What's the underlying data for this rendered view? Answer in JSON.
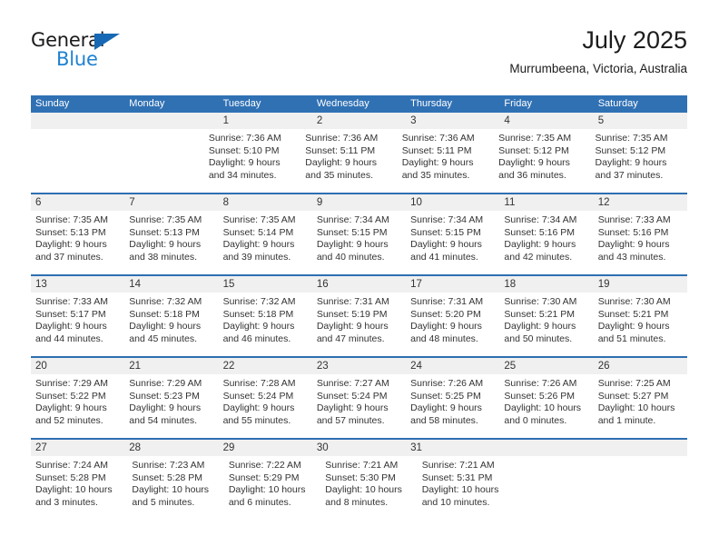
{
  "brand": {
    "name_part1": "General",
    "name_part2": "Blue"
  },
  "header": {
    "title": "July 2025",
    "subtitle": "Murrumbeena, Victoria, Australia"
  },
  "calendar": {
    "weekday_headers": [
      "Sunday",
      "Monday",
      "Tuesday",
      "Wednesday",
      "Thursday",
      "Friday",
      "Saturday"
    ],
    "colors": {
      "header_blue": "#3071b4",
      "rule_blue": "#2f6fb2",
      "daynum_band": "#f0f0f0",
      "logo_blue": "#1f81d0",
      "logo_triangle": "#1769b5"
    },
    "weeks": [
      {
        "days": [
          {
            "num": "",
            "empty": true
          },
          {
            "num": "",
            "empty": true
          },
          {
            "num": "1",
            "sunrise": "Sunrise: 7:36 AM",
            "sunset": "Sunset: 5:10 PM",
            "daylight_line1": "Daylight: 9 hours",
            "daylight_line2": "and 34 minutes."
          },
          {
            "num": "2",
            "sunrise": "Sunrise: 7:36 AM",
            "sunset": "Sunset: 5:11 PM",
            "daylight_line1": "Daylight: 9 hours",
            "daylight_line2": "and 35 minutes."
          },
          {
            "num": "3",
            "sunrise": "Sunrise: 7:36 AM",
            "sunset": "Sunset: 5:11 PM",
            "daylight_line1": "Daylight: 9 hours",
            "daylight_line2": "and 35 minutes."
          },
          {
            "num": "4",
            "sunrise": "Sunrise: 7:35 AM",
            "sunset": "Sunset: 5:12 PM",
            "daylight_line1": "Daylight: 9 hours",
            "daylight_line2": "and 36 minutes."
          },
          {
            "num": "5",
            "sunrise": "Sunrise: 7:35 AM",
            "sunset": "Sunset: 5:12 PM",
            "daylight_line1": "Daylight: 9 hours",
            "daylight_line2": "and 37 minutes."
          }
        ]
      },
      {
        "days": [
          {
            "num": "6",
            "sunrise": "Sunrise: 7:35 AM",
            "sunset": "Sunset: 5:13 PM",
            "daylight_line1": "Daylight: 9 hours",
            "daylight_line2": "and 37 minutes."
          },
          {
            "num": "7",
            "sunrise": "Sunrise: 7:35 AM",
            "sunset": "Sunset: 5:13 PM",
            "daylight_line1": "Daylight: 9 hours",
            "daylight_line2": "and 38 minutes."
          },
          {
            "num": "8",
            "sunrise": "Sunrise: 7:35 AM",
            "sunset": "Sunset: 5:14 PM",
            "daylight_line1": "Daylight: 9 hours",
            "daylight_line2": "and 39 minutes."
          },
          {
            "num": "9",
            "sunrise": "Sunrise: 7:34 AM",
            "sunset": "Sunset: 5:15 PM",
            "daylight_line1": "Daylight: 9 hours",
            "daylight_line2": "and 40 minutes."
          },
          {
            "num": "10",
            "sunrise": "Sunrise: 7:34 AM",
            "sunset": "Sunset: 5:15 PM",
            "daylight_line1": "Daylight: 9 hours",
            "daylight_line2": "and 41 minutes."
          },
          {
            "num": "11",
            "sunrise": "Sunrise: 7:34 AM",
            "sunset": "Sunset: 5:16 PM",
            "daylight_line1": "Daylight: 9 hours",
            "daylight_line2": "and 42 minutes."
          },
          {
            "num": "12",
            "sunrise": "Sunrise: 7:33 AM",
            "sunset": "Sunset: 5:16 PM",
            "daylight_line1": "Daylight: 9 hours",
            "daylight_line2": "and 43 minutes."
          }
        ]
      },
      {
        "days": [
          {
            "num": "13",
            "sunrise": "Sunrise: 7:33 AM",
            "sunset": "Sunset: 5:17 PM",
            "daylight_line1": "Daylight: 9 hours",
            "daylight_line2": "and 44 minutes."
          },
          {
            "num": "14",
            "sunrise": "Sunrise: 7:32 AM",
            "sunset": "Sunset: 5:18 PM",
            "daylight_line1": "Daylight: 9 hours",
            "daylight_line2": "and 45 minutes."
          },
          {
            "num": "15",
            "sunrise": "Sunrise: 7:32 AM",
            "sunset": "Sunset: 5:18 PM",
            "daylight_line1": "Daylight: 9 hours",
            "daylight_line2": "and 46 minutes."
          },
          {
            "num": "16",
            "sunrise": "Sunrise: 7:31 AM",
            "sunset": "Sunset: 5:19 PM",
            "daylight_line1": "Daylight: 9 hours",
            "daylight_line2": "and 47 minutes."
          },
          {
            "num": "17",
            "sunrise": "Sunrise: 7:31 AM",
            "sunset": "Sunset: 5:20 PM",
            "daylight_line1": "Daylight: 9 hours",
            "daylight_line2": "and 48 minutes."
          },
          {
            "num": "18",
            "sunrise": "Sunrise: 7:30 AM",
            "sunset": "Sunset: 5:21 PM",
            "daylight_line1": "Daylight: 9 hours",
            "daylight_line2": "and 50 minutes."
          },
          {
            "num": "19",
            "sunrise": "Sunrise: 7:30 AM",
            "sunset": "Sunset: 5:21 PM",
            "daylight_line1": "Daylight: 9 hours",
            "daylight_line2": "and 51 minutes."
          }
        ]
      },
      {
        "days": [
          {
            "num": "20",
            "sunrise": "Sunrise: 7:29 AM",
            "sunset": "Sunset: 5:22 PM",
            "daylight_line1": "Daylight: 9 hours",
            "daylight_line2": "and 52 minutes."
          },
          {
            "num": "21",
            "sunrise": "Sunrise: 7:29 AM",
            "sunset": "Sunset: 5:23 PM",
            "daylight_line1": "Daylight: 9 hours",
            "daylight_line2": "and 54 minutes."
          },
          {
            "num": "22",
            "sunrise": "Sunrise: 7:28 AM",
            "sunset": "Sunset: 5:24 PM",
            "daylight_line1": "Daylight: 9 hours",
            "daylight_line2": "and 55 minutes."
          },
          {
            "num": "23",
            "sunrise": "Sunrise: 7:27 AM",
            "sunset": "Sunset: 5:24 PM",
            "daylight_line1": "Daylight: 9 hours",
            "daylight_line2": "and 57 minutes."
          },
          {
            "num": "24",
            "sunrise": "Sunrise: 7:26 AM",
            "sunset": "Sunset: 5:25 PM",
            "daylight_line1": "Daylight: 9 hours",
            "daylight_line2": "and 58 minutes."
          },
          {
            "num": "25",
            "sunrise": "Sunrise: 7:26 AM",
            "sunset": "Sunset: 5:26 PM",
            "daylight_line1": "Daylight: 10 hours",
            "daylight_line2": "and 0 minutes."
          },
          {
            "num": "26",
            "sunrise": "Sunrise: 7:25 AM",
            "sunset": "Sunset: 5:27 PM",
            "daylight_line1": "Daylight: 10 hours",
            "daylight_line2": "and 1 minute."
          }
        ]
      },
      {
        "days": [
          {
            "num": "27",
            "sunrise": "Sunrise: 7:24 AM",
            "sunset": "Sunset: 5:28 PM",
            "daylight_line1": "Daylight: 10 hours",
            "daylight_line2": "and 3 minutes."
          },
          {
            "num": "28",
            "sunrise": "Sunrise: 7:23 AM",
            "sunset": "Sunset: 5:28 PM",
            "daylight_line1": "Daylight: 10 hours",
            "daylight_line2": "and 5 minutes."
          },
          {
            "num": "29",
            "sunrise": "Sunrise: 7:22 AM",
            "sunset": "Sunset: 5:29 PM",
            "daylight_line1": "Daylight: 10 hours",
            "daylight_line2": "and 6 minutes."
          },
          {
            "num": "30",
            "sunrise": "Sunrise: 7:21 AM",
            "sunset": "Sunset: 5:30 PM",
            "daylight_line1": "Daylight: 10 hours",
            "daylight_line2": "and 8 minutes."
          },
          {
            "num": "31",
            "sunrise": "Sunrise: 7:21 AM",
            "sunset": "Sunset: 5:31 PM",
            "daylight_line1": "Daylight: 10 hours",
            "daylight_line2": "and 10 minutes."
          },
          {
            "num": "",
            "empty": true
          },
          {
            "num": "",
            "empty": true
          }
        ]
      }
    ]
  }
}
